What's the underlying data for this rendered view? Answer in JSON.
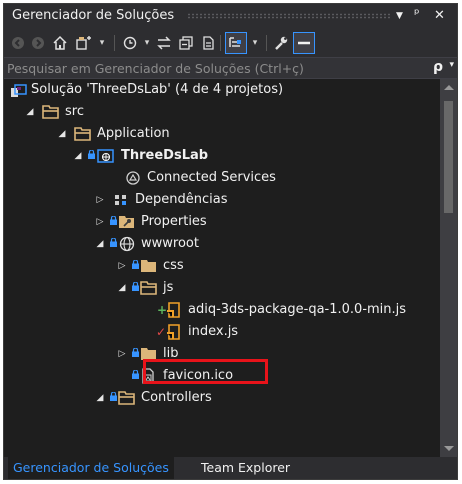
{
  "panel": {
    "title": "Gerenciador de Soluções",
    "pin_glyph": "ᵖ",
    "close_glyph": "✕"
  },
  "search": {
    "placeholder": "Pesquisar em Gerenciador de Soluções (Ctrl+ç)"
  },
  "tree": [
    {
      "label": "Solução 'ThreeDsLab' (4 de 4 projetos)",
      "icon": "solution-icon",
      "level": 0,
      "expander": "none",
      "bold": false
    },
    {
      "label": "src",
      "icon": "folder-open-icon",
      "level": 1,
      "expander": "expanded",
      "bold": false
    },
    {
      "label": "Application",
      "icon": "folder-open-icon",
      "level": 2,
      "expander": "expanded",
      "bold": false
    },
    {
      "label": "ThreeDsLab",
      "icon": "web-project-icon",
      "level": 3,
      "expander": "expanded",
      "bold": true
    },
    {
      "label": "Connected Services",
      "icon": "connected-services-icon",
      "level": 4,
      "expander": "none",
      "bold": false
    },
    {
      "label": "Dependências",
      "icon": "dependencies-icon",
      "level": 4,
      "expander": "collapsed",
      "bold": false
    },
    {
      "label": "Properties",
      "icon": "properties-icon",
      "level": 4,
      "expander": "collapsed",
      "bold": false
    },
    {
      "label": "wwwroot",
      "icon": "globe-icon",
      "level": 4,
      "expander": "expanded",
      "bold": false
    },
    {
      "label": "css",
      "icon": "folder-icon",
      "level": 5,
      "expander": "collapsed",
      "bold": false
    },
    {
      "label": "js",
      "icon": "folder-open-icon",
      "level": 5,
      "expander": "expanded",
      "bold": false
    },
    {
      "label": "adiq-3ds-package-qa-1.0.0-min.js",
      "icon": "js-file-icon",
      "level": 6,
      "expander": "none",
      "bold": false,
      "status": "added"
    },
    {
      "label": "index.js",
      "icon": "js-file-icon",
      "level": 6,
      "expander": "none",
      "bold": false,
      "status": "modified"
    },
    {
      "label": "lib",
      "icon": "folder-icon",
      "level": 5,
      "expander": "collapsed",
      "bold": false
    },
    {
      "label": "favicon.ico",
      "icon": "ico-file-icon",
      "level": 5,
      "expander": "none",
      "bold": false
    },
    {
      "label": "Controllers",
      "icon": "folder-open-icon",
      "level": 4,
      "expander": "expanded",
      "bold": false
    }
  ],
  "tabs": [
    {
      "label": "Gerenciador de Soluções",
      "active": true
    },
    {
      "label": "Team Explorer",
      "active": false
    }
  ],
  "colors": {
    "accent_tab": "#3794ff",
    "highlight_box": "#e8131a",
    "folder": "#dcb67a",
    "js_file": "#f0a028",
    "added_status": "#5fb75f",
    "modified_status": "#e04848"
  }
}
